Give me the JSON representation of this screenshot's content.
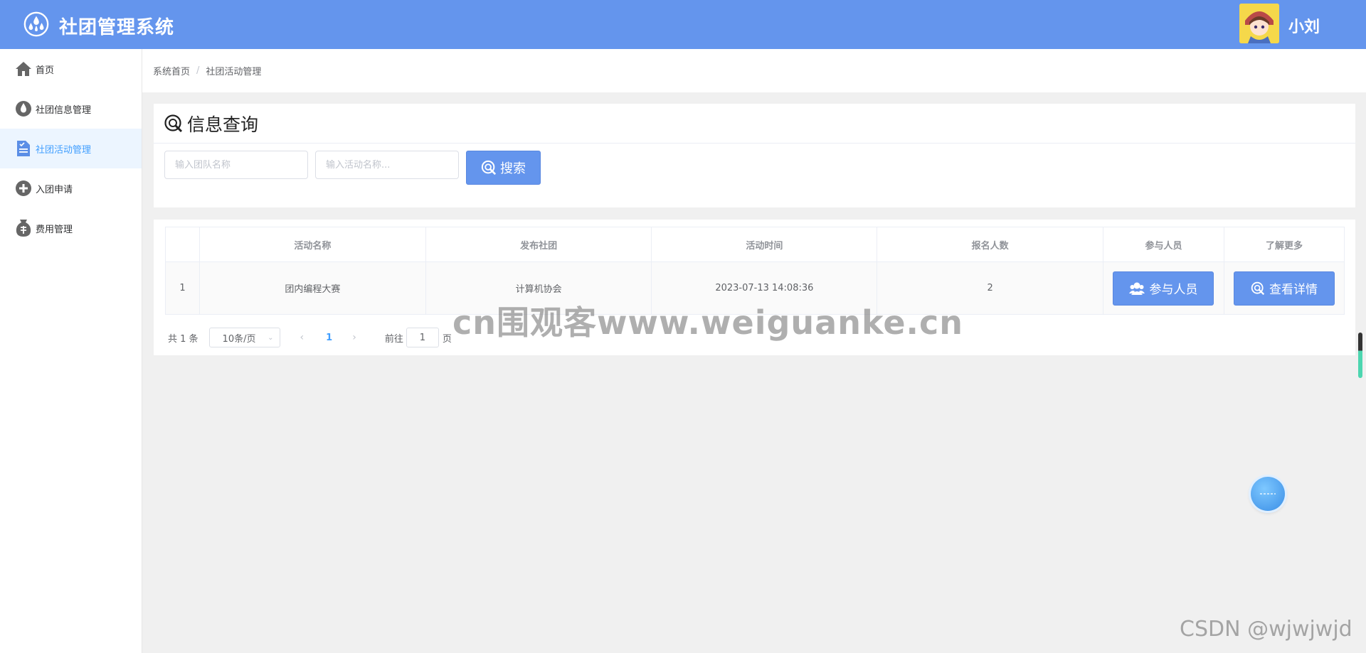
{
  "header": {
    "app_title": "社团管理系统",
    "username": "小刘"
  },
  "sidebar": {
    "items": [
      {
        "label": "首页",
        "icon": "home-icon"
      },
      {
        "label": "社团信息管理",
        "icon": "droplet-icon"
      },
      {
        "label": "社团活动管理",
        "icon": "document-icon",
        "active": true
      },
      {
        "label": "入团申请",
        "icon": "plus-circle-icon"
      },
      {
        "label": "费用管理",
        "icon": "money-icon"
      }
    ]
  },
  "breadcrumb": {
    "home": "系统首页",
    "separator": "/",
    "current": "社团活动管理"
  },
  "query": {
    "title": "信息查询",
    "team_placeholder": "输入团队名称",
    "activity_placeholder": "输入活动名称...",
    "search_label": "搜索"
  },
  "table": {
    "headers": [
      "",
      "活动名称",
      "发布社团",
      "活动时间",
      "报名人数",
      "参与人员",
      "了解更多"
    ],
    "rows": [
      {
        "index": "1",
        "name": "团内编程大赛",
        "club": "计算机协会",
        "time": "2023-07-13 14:08:36",
        "count": "2",
        "participants_btn": "参与人员",
        "detail_btn": "查看详情"
      }
    ]
  },
  "pagination": {
    "total": "共 1 条",
    "page_size": "10条/页",
    "current_page": "1",
    "goto_prefix": "前往",
    "goto_value": "1",
    "goto_suffix": "页"
  },
  "overlays": {
    "watermark": "cn围观客www.weiguanke.cn",
    "csdn": "CSDN @wjwjwjd"
  },
  "colors": {
    "header_bg": "#6495ed",
    "button_bg": "#6495ed",
    "active_menu_text": "#409eff"
  }
}
